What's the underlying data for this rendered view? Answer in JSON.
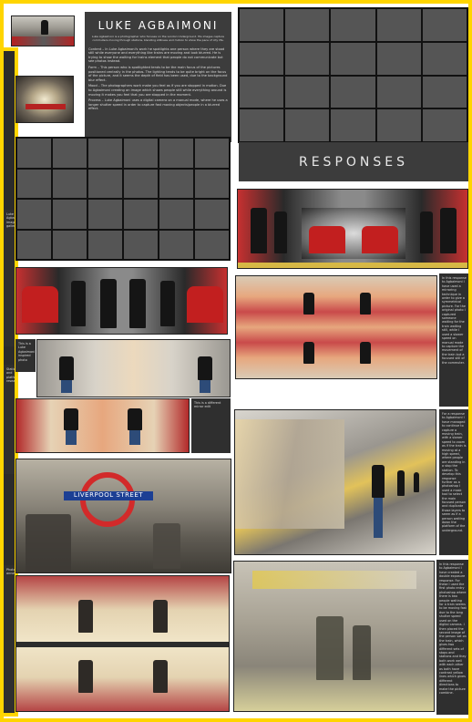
{
  "header": {
    "title": "LUKE AGBAIMONI",
    "intro": "Luke Agbaimoni is a photographer who focuses on the London Underground. His images capture commuters moving through stations, blending stillness and motion to show the pace of city life.",
    "paragraphs": [
      "Content – In Luke Agbaimoni's work he spotlights one person where they are stood still while everyone and everything like trains are moving and look blurred. He is trying to show the waiting for trains element that people do not communicate but see photos instead.",
      "Form – This person who is spotlighted tends to be the main focus of the pictures positioned centrally in the photos. The lighting tends to be quite bright on the focus of the picture, and it seems the depth of field has been used, due to the background blur effect.",
      "Mood – The photographers work make you feel as if you are stopped in motion. Due to Agbaimoni creating an image which shows people still while everything around is moving it makes you feel that you are stopped in the moment.",
      "Process – Luke Agbaimoni uses a digital camera on a manual mode, where he uses a longer shutter speed in order to capture fast moving objects/people in a blurred effect."
    ]
  },
  "responses": {
    "title": "RESPONSES"
  },
  "side_notes": [
    "In this response to Agbaimoni I have used a mirroring technique in order to give a symmetrical picture. For the original photo I captured someone waiting for the train waiting still, while I used a slower speed on manual mode to capture the movement of the train but a focused still of the commuter.",
    "This is from the same original photo; however I have cut a part from that of symmetry at the different ends of the photo. This has given the picture a different effect.",
    "For a response to Agbaimoni I have managed to continue to capture a moving train, with a slower speed to zoom as if the train is moving at a high speed, where people are standing in a stop the station. To develop this response further as a photoshop I used a mask tool to select the main focused person and duplicate those layers to seem as if a person waiting down the platform of the underground.",
    "In this response to Agbaimoni I have created a double exposure response. For these I used the first photo entry photoshop where there is two people waiting for a train seems to be moving fast due to the long shutter speed used on the digital camera. I then placed the second image of the person sat on the train, which gives two different sets of stops and stations and they both work well with each other as both have contrast yellow lines which gives different directions to make the picture combine."
  ],
  "small_notes": [
    "This is a Luke Agbaimoni inspired photo",
    "This is a different mirror edit"
  ],
  "sign": {
    "line1": "LIVERPOOL",
    "line2": "STREET"
  },
  "left_column_notes": [
    "Luke Agbaimoni images gallery",
    "Station and platform research",
    "Photographer annotations"
  ]
}
